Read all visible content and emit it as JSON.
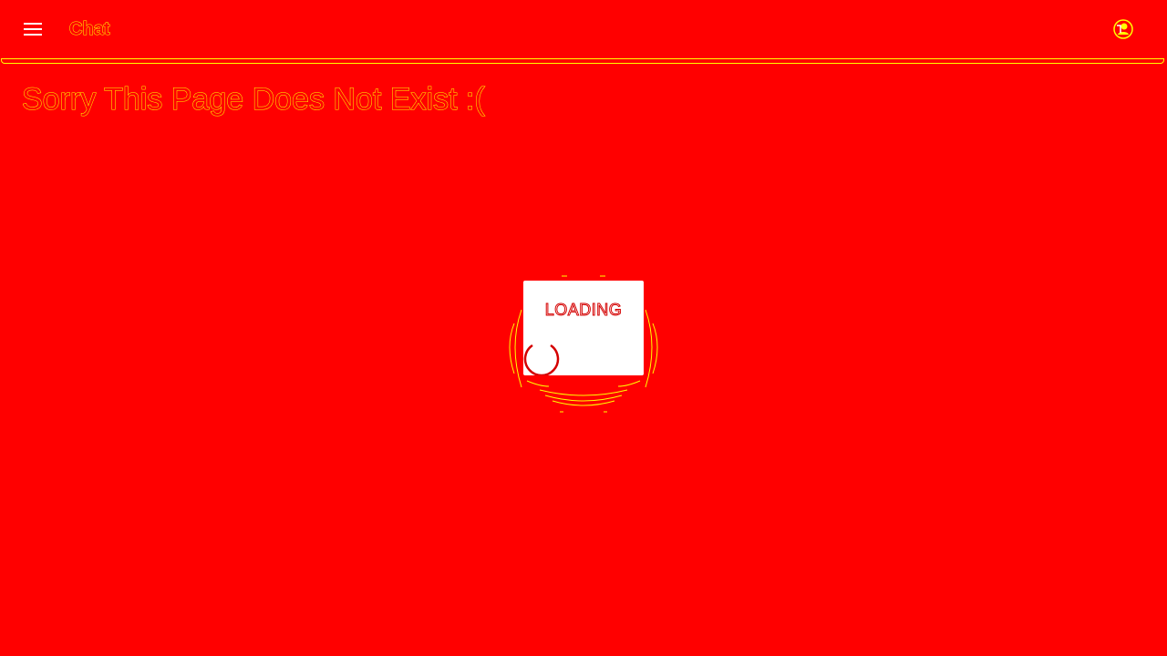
{
  "header": {
    "menu_icon": "menu-icon",
    "title": "Chat",
    "account_icon": "account-icon"
  },
  "main": {
    "message": "Sorry This Page Does Not Exist :("
  },
  "loading": {
    "label": "LOADING",
    "spinner_icon": "spinner-icon"
  },
  "colors": {
    "background": "#ff0000",
    "outline": "#ffff00",
    "card": "#ffffff",
    "spinner": "#d40000"
  }
}
